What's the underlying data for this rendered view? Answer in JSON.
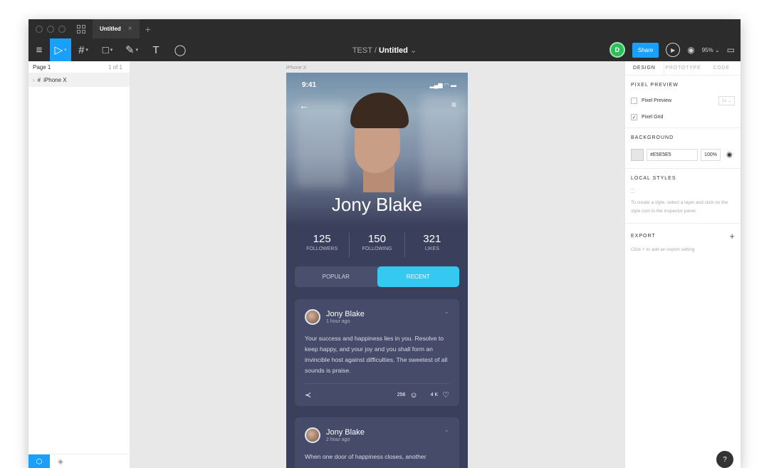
{
  "tabbar": {
    "tab_label": "Untitled",
    "close": "×",
    "add": "+"
  },
  "toolbar": {
    "file_project": "TEST",
    "file_sep": "/",
    "file_name": "Untitled",
    "file_caret": "⌄",
    "avatar_initial": "D",
    "share_label": "Share",
    "zoom_label": "95% ⌄"
  },
  "left_panel": {
    "page_label": "Page 1",
    "page_count": "1 of 1",
    "layer_label": "iPhone X"
  },
  "canvas": {
    "frame_label": "iPhone X"
  },
  "phone": {
    "status_time": "9:41",
    "profile_name": "Jony Blake",
    "stats": [
      {
        "value": "125",
        "label": "FOLLOWERS"
      },
      {
        "value": "150",
        "label": "FOLLOWING"
      },
      {
        "value": "321",
        "label": "LIKES"
      }
    ],
    "tabs": {
      "popular": "POPULAR",
      "recent": "RECENT"
    },
    "posts": [
      {
        "author": "Jony Blake",
        "time": "1 hour ago",
        "body": "Your success and happiness lies in you. Resolve to keep happy, and your joy and you shall form an invincible host against difficulties. The sweetest of all sounds is praise.",
        "comments": "256",
        "likes": "4 K"
      },
      {
        "author": "Jony Blake",
        "time": "2 hour ago",
        "body": "When one door of happiness closes, another"
      }
    ]
  },
  "right_panel": {
    "tabs": {
      "design": "DESIGN",
      "prototype": "PROTOTYPE",
      "code": "CODE"
    },
    "pixel_preview": {
      "title": "PIXEL PREVIEW",
      "preview_label": "Pixel Preview",
      "scale_value": "1x",
      "grid_label": "Pixel Grid"
    },
    "background": {
      "title": "BACKGROUND",
      "hex": "#E5E5E5",
      "opacity": "100%"
    },
    "local_styles": {
      "title": "LOCAL STYLES",
      "hint": "To create a style, select a layer and click on the style icon in the inspector panel."
    },
    "export": {
      "title": "EXPORT",
      "hint": "Click + to add an export setting"
    },
    "help": "?"
  },
  "colors": {
    "accent": "#18a0fb",
    "segment_active": "#35c8f0",
    "phone_bg": "#3a3f5c"
  }
}
